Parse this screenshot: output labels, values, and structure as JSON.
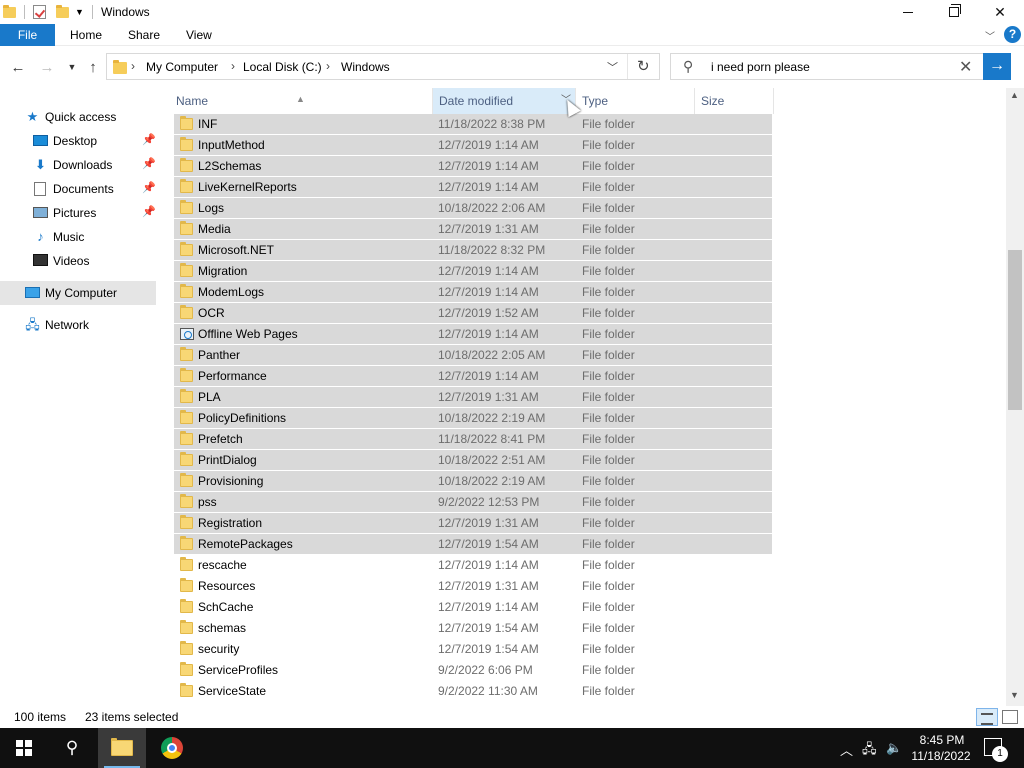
{
  "window": {
    "title": "Windows"
  },
  "ribbon": {
    "tabs": [
      "File",
      "Home",
      "Share",
      "View"
    ],
    "help_label": "?"
  },
  "address": {
    "crumbs": [
      "My Computer",
      "Local Disk (C:)",
      "Windows"
    ]
  },
  "search": {
    "value": "i need porn please"
  },
  "sidebar": {
    "items": [
      {
        "label": "Quick access"
      },
      {
        "label": "Desktop"
      },
      {
        "label": "Downloads"
      },
      {
        "label": "Documents"
      },
      {
        "label": "Pictures"
      },
      {
        "label": "Music"
      },
      {
        "label": "Videos"
      },
      {
        "label": "My Computer"
      },
      {
        "label": "Network"
      }
    ]
  },
  "columns": {
    "name": "Name",
    "date": "Date modified",
    "type": "Type",
    "size": "Size"
  },
  "files": [
    {
      "name": "INF",
      "date": "11/18/2022 8:38 PM",
      "type": "File folder"
    },
    {
      "name": "InputMethod",
      "date": "12/7/2019 1:14 AM",
      "type": "File folder"
    },
    {
      "name": "L2Schemas",
      "date": "12/7/2019 1:14 AM",
      "type": "File folder"
    },
    {
      "name": "LiveKernelReports",
      "date": "12/7/2019 1:14 AM",
      "type": "File folder"
    },
    {
      "name": "Logs",
      "date": "10/18/2022 2:06 AM",
      "type": "File folder"
    },
    {
      "name": "Media",
      "date": "12/7/2019 1:31 AM",
      "type": "File folder"
    },
    {
      "name": "Microsoft.NET",
      "date": "11/18/2022 8:32 PM",
      "type": "File folder"
    },
    {
      "name": "Migration",
      "date": "12/7/2019 1:14 AM",
      "type": "File folder"
    },
    {
      "name": "ModemLogs",
      "date": "12/7/2019 1:14 AM",
      "type": "File folder"
    },
    {
      "name": "OCR",
      "date": "12/7/2019 1:52 AM",
      "type": "File folder"
    },
    {
      "name": "Offline Web Pages",
      "date": "12/7/2019 1:14 AM",
      "type": "File folder"
    },
    {
      "name": "Panther",
      "date": "10/18/2022 2:05 AM",
      "type": "File folder"
    },
    {
      "name": "Performance",
      "date": "12/7/2019 1:14 AM",
      "type": "File folder"
    },
    {
      "name": "PLA",
      "date": "12/7/2019 1:31 AM",
      "type": "File folder"
    },
    {
      "name": "PolicyDefinitions",
      "date": "10/18/2022 2:19 AM",
      "type": "File folder"
    },
    {
      "name": "Prefetch",
      "date": "11/18/2022 8:41 PM",
      "type": "File folder"
    },
    {
      "name": "PrintDialog",
      "date": "10/18/2022 2:51 AM",
      "type": "File folder"
    },
    {
      "name": "Provisioning",
      "date": "10/18/2022 2:19 AM",
      "type": "File folder"
    },
    {
      "name": "pss",
      "date": "9/2/2022 12:53 PM",
      "type": "File folder"
    },
    {
      "name": "Registration",
      "date": "12/7/2019 1:31 AM",
      "type": "File folder"
    },
    {
      "name": "RemotePackages",
      "date": "12/7/2019 1:54 AM",
      "type": "File folder"
    },
    {
      "name": "rescache",
      "date": "12/7/2019 1:14 AM",
      "type": "File folder"
    },
    {
      "name": "Resources",
      "date": "12/7/2019 1:31 AM",
      "type": "File folder"
    },
    {
      "name": "SchCache",
      "date": "12/7/2019 1:14 AM",
      "type": "File folder"
    },
    {
      "name": "schemas",
      "date": "12/7/2019 1:54 AM",
      "type": "File folder"
    },
    {
      "name": "security",
      "date": "12/7/2019 1:54 AM",
      "type": "File folder"
    },
    {
      "name": "ServiceProfiles",
      "date": "9/2/2022 6:06 PM",
      "type": "File folder"
    },
    {
      "name": "ServiceState",
      "date": "9/2/2022 11:30 AM",
      "type": "File folder"
    }
  ],
  "selection": {
    "selected_row_count": 21
  },
  "status": {
    "items": "100 items",
    "selected": "23 items selected"
  },
  "taskbar": {
    "time": "8:45 PM",
    "date": "11/18/2022",
    "notification_count": "1"
  },
  "colors": {
    "accent": "#1979ca",
    "selection": "#d9d9d9",
    "header_hover": "#d9ebf9",
    "taskbar": "#101010"
  }
}
